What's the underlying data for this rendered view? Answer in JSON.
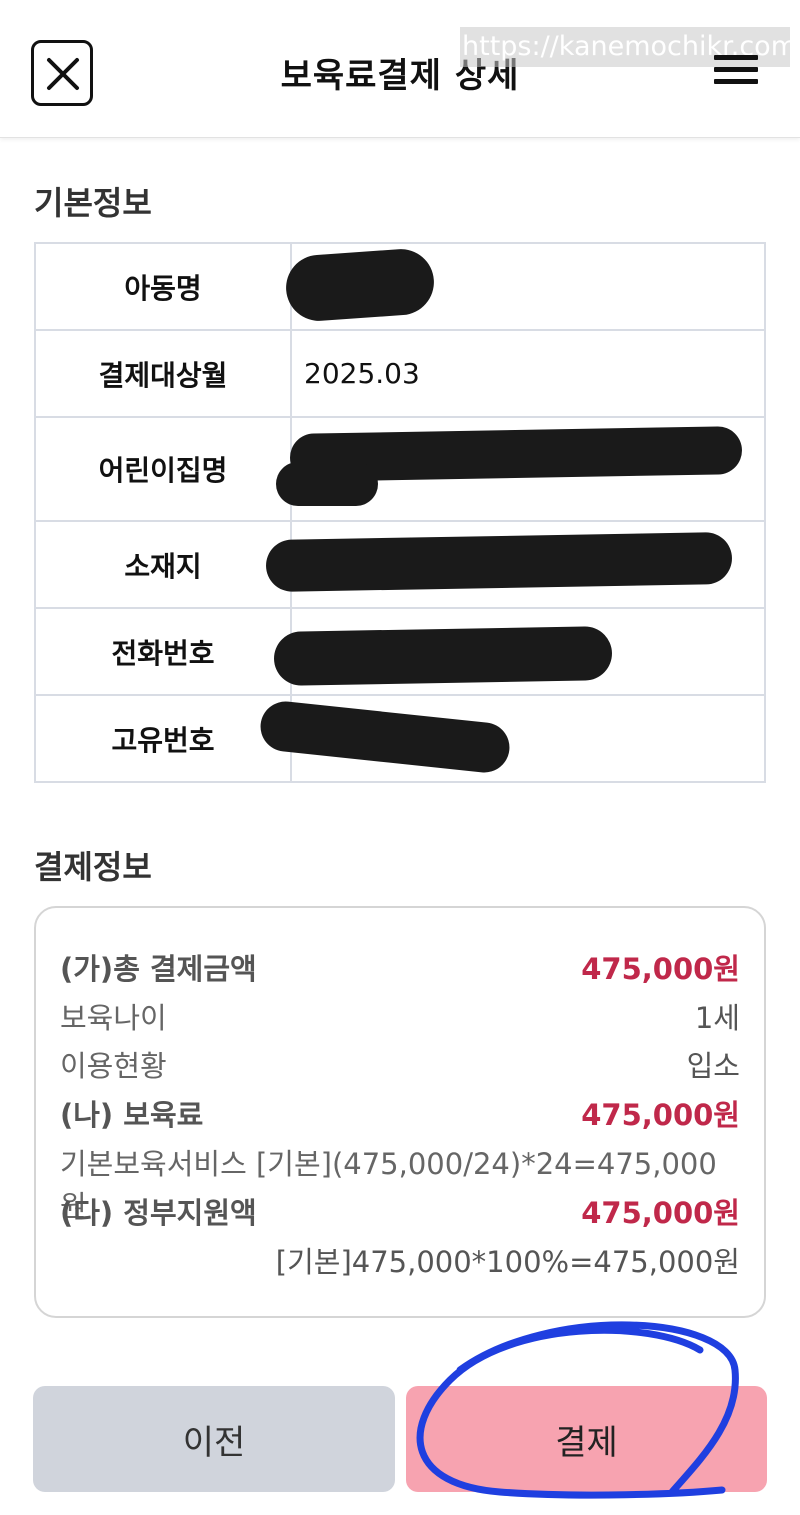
{
  "header": {
    "title": "보육료결제 상세",
    "watermark": "https://kanemochikr.com"
  },
  "basic_info": {
    "section_title": "기본정보",
    "rows": [
      {
        "label": "아동명",
        "value": ""
      },
      {
        "label": "결제대상월",
        "value": "2025.03"
      },
      {
        "label": "어린이집명",
        "value": ""
      },
      {
        "label": "소재지",
        "value": ""
      },
      {
        "label": "전화번호",
        "value": ""
      },
      {
        "label": "고유번호",
        "value": ""
      }
    ]
  },
  "payment_info": {
    "section_title": "결제정보",
    "total_label": "(가)총 결제금액",
    "total_value": "475,000원",
    "age_label": "보육나이",
    "age_value": "1세",
    "status_label": "이용현황",
    "status_value": "입소",
    "fee_label": "(나) 보육료",
    "fee_value": "475,000원",
    "fee_detail": "기본보육서비스 [기본](475,000/24)*24=475,000원",
    "support_label": "(다) 정부지원액",
    "support_value": "475,000원",
    "support_detail": "[기본]475,000*100%=475,000원"
  },
  "buttons": {
    "prev_label": "이전",
    "pay_label": "결제"
  },
  "colors": {
    "accent_red": "#c0284a",
    "pay_button": "#f7a3b0",
    "prev_button": "#d0d4dc",
    "annotation": "#1f3fe0"
  },
  "icons": {
    "close": "close-icon",
    "menu": "hamburger-menu-icon"
  }
}
